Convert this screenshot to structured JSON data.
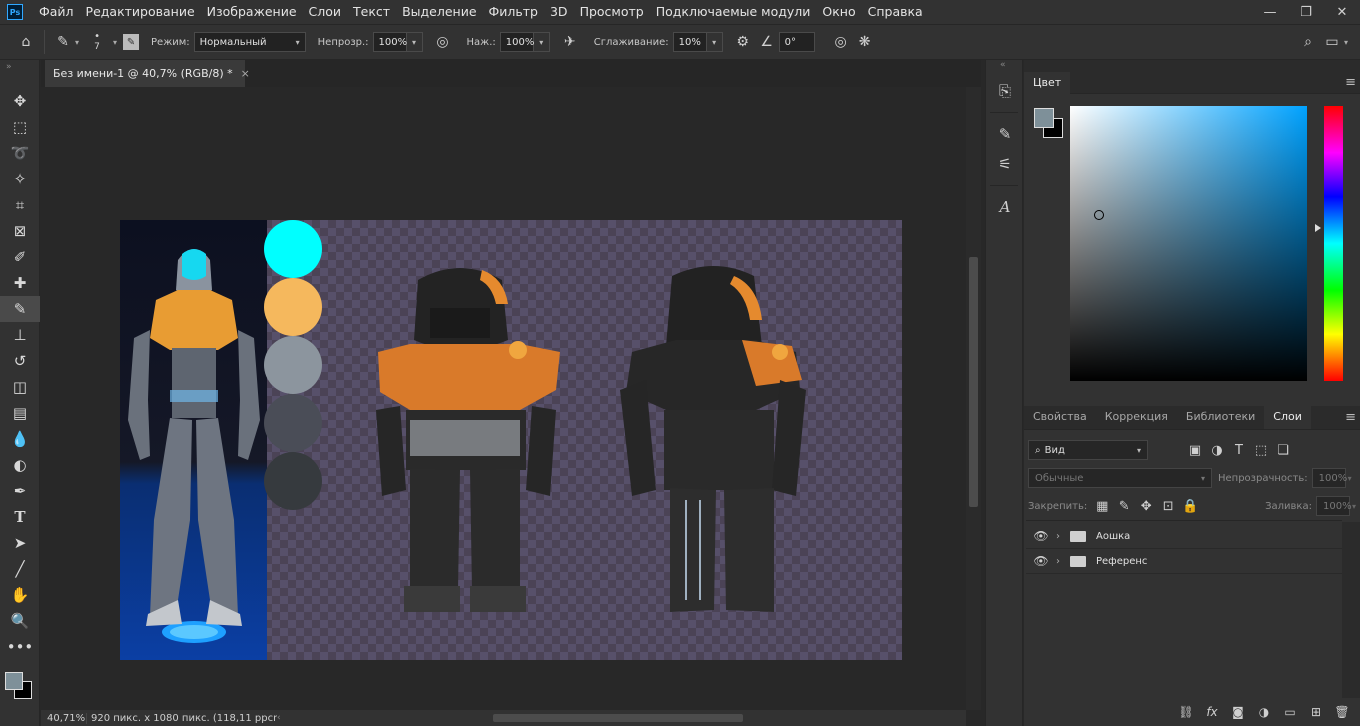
{
  "menubar": {
    "logo": "Ps",
    "items": [
      "Файл",
      "Редактирование",
      "Изображение",
      "Слои",
      "Текст",
      "Выделение",
      "Фильтр",
      "3D",
      "Просмотр",
      "Подключаемые модули",
      "Окно",
      "Справка"
    ],
    "window_controls": [
      "—",
      "❐",
      "✕"
    ]
  },
  "options": {
    "brush_size": "7",
    "mode_label": "Режим:",
    "mode_value": "Нормальный",
    "opacity_label": "Непрозр.:",
    "opacity_value": "100%",
    "flow_label": "Наж.:",
    "flow_value": "100%",
    "smoothing_label": "Сглаживание:",
    "smoothing_value": "10%",
    "angle_value": "0°"
  },
  "document": {
    "tab_title": "Без имени-1 @ 40,7% (RGB/8) *",
    "close": "×"
  },
  "swatches": [
    "#00ffff",
    "#f5b85d",
    "#8c959e",
    "#4a4d57",
    "#363a3e"
  ],
  "statusbar": {
    "zoom": "40,71%",
    "info": "920 пикс. x 1080 пикс. (118,11 ppcm)"
  },
  "color_panel": {
    "title": "Цвет",
    "foreground": "#7e9099",
    "background": "#000000",
    "hue_color": "#00a2ff"
  },
  "layers_panel": {
    "tabs": [
      "Свойства",
      "Коррекция",
      "Библиотеки",
      "Слои"
    ],
    "active_tab": "Слои",
    "filter_value": "Вид",
    "blend_mode": "Обычные",
    "opacity_label": "Непрозрачность:",
    "opacity_value": "100%",
    "lock_label": "Закрепить:",
    "fill_label": "Заливка:",
    "fill_value": "100%",
    "layers": [
      {
        "name": "Аошка",
        "visible": true,
        "type": "group"
      },
      {
        "name": "Референс",
        "visible": true,
        "type": "group"
      }
    ]
  }
}
